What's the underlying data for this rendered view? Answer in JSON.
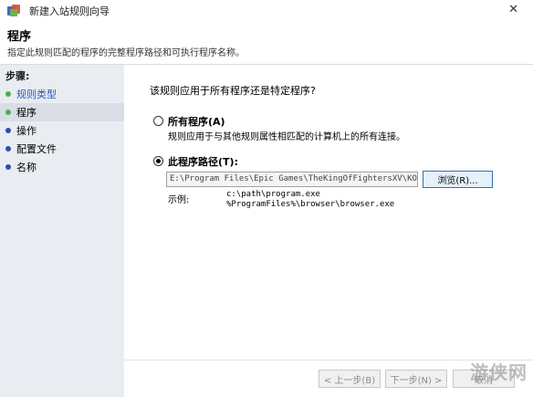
{
  "window": {
    "title": "新建入站规则向导",
    "icon": "firewall-app-icon",
    "close_glyph": "✕"
  },
  "header": {
    "title": "程序",
    "subtitle": "指定此规则匹配的程序的完整程序路径和可执行程序名称。"
  },
  "steps": {
    "title": "步骤:",
    "items": [
      {
        "label": "规则类型",
        "state": "done"
      },
      {
        "label": "程序",
        "state": "current"
      },
      {
        "label": "操作",
        "state": "todo"
      },
      {
        "label": "配置文件",
        "state": "todo"
      },
      {
        "label": "名称",
        "state": "todo"
      }
    ]
  },
  "main": {
    "question": "该规则应用于所有程序还是特定程序?",
    "option_all": {
      "label": "所有程序(A)",
      "description": "规则应用于与其他规则属性相匹配的计算机上的所有连接。",
      "selected": false
    },
    "option_path": {
      "label": "此程序路径(T):",
      "selected": true
    },
    "path_value": "E:\\Program Files\\Epic Games\\TheKingOfFightersXV\\KOFXV\\Bi",
    "browse_label": "浏览(R)...",
    "example_label": "示例:",
    "example_line1": "c:\\path\\program.exe",
    "example_line2": "%ProgramFiles%\\browser\\browser.exe"
  },
  "buttons": {
    "back": "< 上一步(B)",
    "next": "下一步(N) >",
    "cancel": "取消"
  },
  "watermark": "游侠网",
  "colors": {
    "accent": "#2f6ebf",
    "step_done_dot": "#4caf50",
    "step_todo_dot": "#2f4fae",
    "sidebar_bg": "#e9ecf1"
  }
}
